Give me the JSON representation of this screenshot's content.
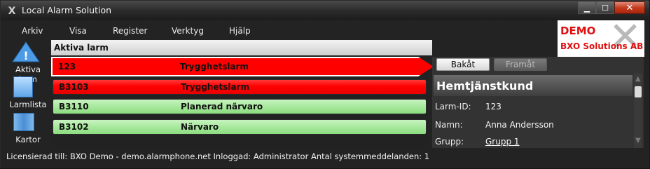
{
  "window": {
    "title": "Local Alarm Solution",
    "app_icon_glyph": "X",
    "controls": {
      "minimize": "▁",
      "maximize": "☐",
      "close": "✕"
    }
  },
  "menu": [
    "Arkiv",
    "Visa",
    "Register",
    "Verktyg",
    "Hjälp"
  ],
  "logo": {
    "demo": "DEMO",
    "company": "BXO Solutions AB"
  },
  "sidebar": {
    "items": [
      {
        "label": "Aktiva larm",
        "icon": "warning-triangle-icon"
      },
      {
        "label": "Larmlista",
        "icon": "book-icon"
      },
      {
        "label": "Kartor",
        "icon": "map-icon"
      }
    ]
  },
  "alarms_panel": {
    "header": "Aktiva larm",
    "rows": [
      {
        "id": "123",
        "type": "Trygghetslarm",
        "status": "red",
        "selected": true
      },
      {
        "id": "B3103",
        "type": "Trygghetslarm",
        "status": "red",
        "selected": false
      },
      {
        "id": "B3110",
        "type": "Planerad närvaro",
        "status": "green",
        "selected": false
      },
      {
        "id": "B3102",
        "type": "Närvaro",
        "status": "green",
        "selected": false
      }
    ],
    "colors": {
      "red": "#ff0000",
      "green": "#a5e89a"
    }
  },
  "detail": {
    "back_label": "Bakåt",
    "forward_label": "Framåt",
    "title": "Hemtjänstkund",
    "fields": [
      {
        "label": "Larm-ID:",
        "value": "123"
      },
      {
        "label": "Namn:",
        "value": "Anna Andersson"
      },
      {
        "label": "Grupp:",
        "value": "Grupp 1"
      }
    ]
  },
  "status": {
    "text": "Licensierad till: BXO Demo - demo.alarmphone.net  Inloggad:  Administrator  Antal systemmeddelanden: 1"
  }
}
